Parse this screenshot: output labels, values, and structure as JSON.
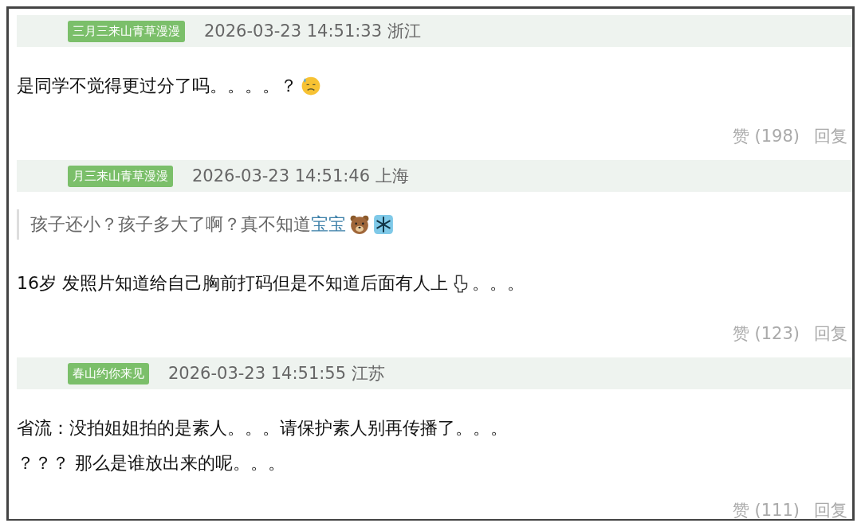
{
  "comments": [
    {
      "badge": "三月三来山青草漫漫",
      "time": "2026-03-23 14:51:33",
      "location": "浙江",
      "lines": [
        [
          {
            "kind": "text",
            "text": "是同学不觉得更过分了吗。。。。？"
          },
          {
            "kind": "face"
          }
        ]
      ],
      "likes": "赞 (198)",
      "reply": "回复"
    },
    {
      "badge": "月三来山青草漫漫",
      "time": "2026-03-23 14:51:46",
      "location": "上海",
      "quote": [
        {
          "kind": "text",
          "text": "孩子还小？孩子多大了啊？真不知道 "
        },
        {
          "kind": "link",
          "text": "宝宝"
        },
        {
          "kind": "bear"
        },
        {
          "kind": "snowflake"
        }
      ],
      "lines": [
        [
          {
            "kind": "text",
            "text": "16岁 发照片知道给自己胸前打码但是不知道后面有人上"
          },
          {
            "kind": "toilet"
          },
          {
            "kind": "text",
            "text": "。。。"
          }
        ]
      ],
      "likes": "赞 (123)",
      "reply": "回复"
    },
    {
      "badge": "春山约你来见",
      "time": "2026-03-23 14:51:55",
      "location": "江苏",
      "lines": [
        [
          {
            "kind": "text",
            "text": "省流：没拍姐姐拍的是素人。。。请保护素人别再传播了。。。"
          }
        ],
        [
          {
            "kind": "text",
            "text": "？？？ 那么是谁放出来的呢。。。"
          }
        ]
      ],
      "likes": "赞 (111)",
      "reply": "回复"
    }
  ]
}
